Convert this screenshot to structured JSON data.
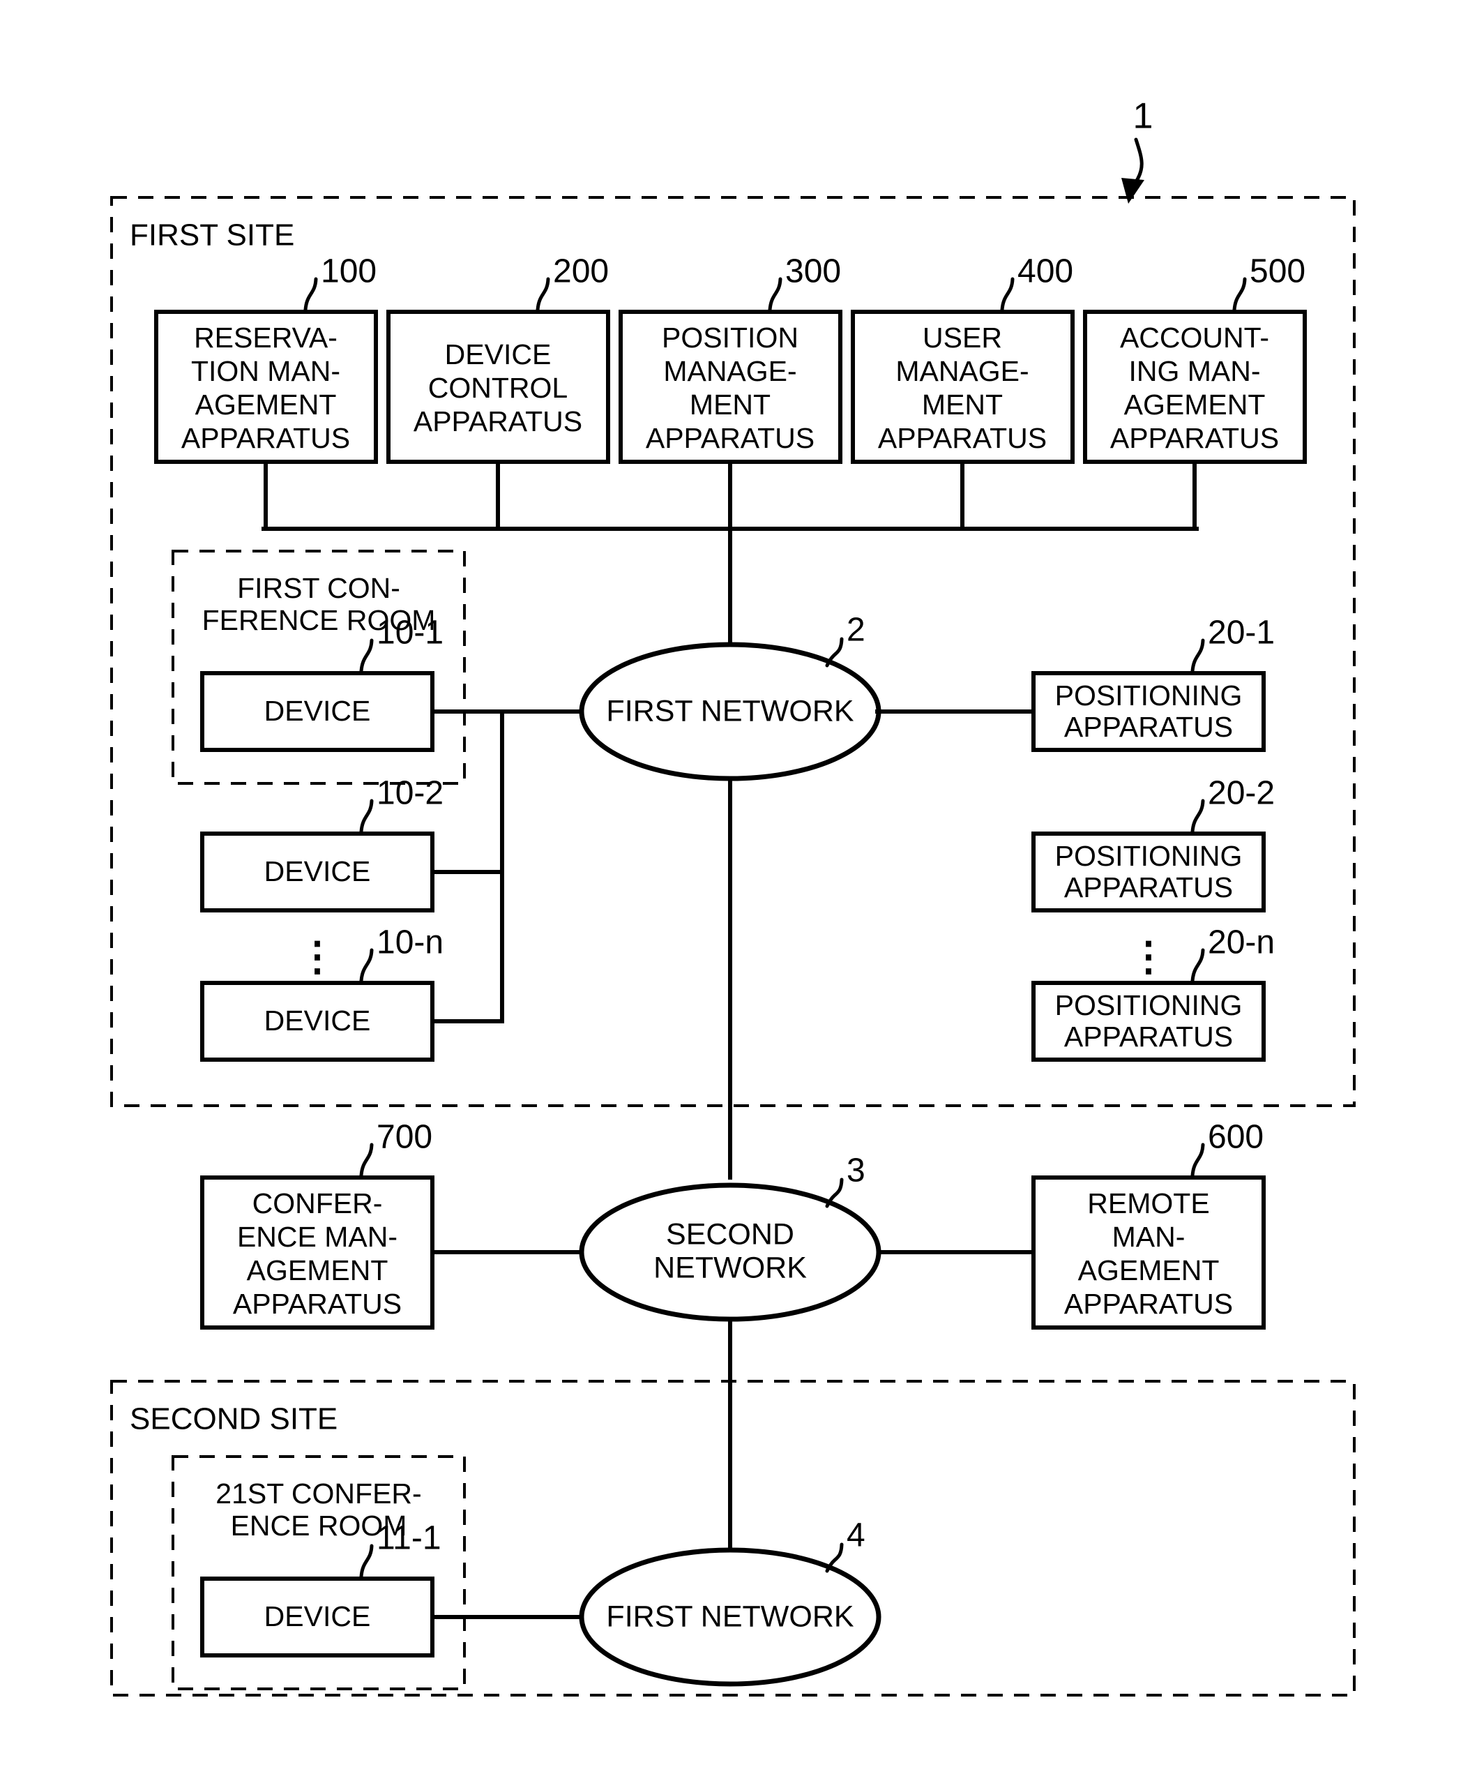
{
  "figure": {
    "reference_label": "1"
  },
  "regions": [
    {
      "id": "first-site",
      "label": "FIRST SITE"
    },
    {
      "id": "second-site",
      "label": "SECOND SITE"
    }
  ],
  "rooms": [
    {
      "id": "first-conference-room",
      "lines": [
        "FIRST CON-",
        "FERENCE ROOM"
      ]
    },
    {
      "id": "twenty-first-conference-room",
      "lines": [
        "21ST CONFER-",
        "ENCE ROOM"
      ]
    }
  ],
  "management_boxes": [
    {
      "ref": "100",
      "lines": [
        "RESERVA-",
        "TION MAN-",
        "AGEMENT",
        "APPARATUS"
      ]
    },
    {
      "ref": "200",
      "lines": [
        "DEVICE",
        "CONTROL",
        "APPARATUS"
      ]
    },
    {
      "ref": "300",
      "lines": [
        "POSITION",
        "MANAGE-",
        "MENT",
        "APPARATUS"
      ]
    },
    {
      "ref": "400",
      "lines": [
        "USER",
        "MANAGE-",
        "MENT",
        "APPARATUS"
      ]
    },
    {
      "ref": "500",
      "lines": [
        "ACCOUNT-",
        "ING MAN-",
        "AGEMENT",
        "APPARATUS"
      ]
    }
  ],
  "devices": [
    {
      "ref": "10-1",
      "label": "DEVICE"
    },
    {
      "ref": "10-2",
      "label": "DEVICE"
    },
    {
      "ref": "10-n",
      "label": "DEVICE"
    },
    {
      "ref": "11-1",
      "label": "DEVICE"
    }
  ],
  "positioning_apparatuses": [
    {
      "ref": "20-1",
      "lines": [
        "POSITIONING",
        "APPARATUS"
      ]
    },
    {
      "ref": "20-2",
      "lines": [
        "POSITIONING",
        "APPARATUS"
      ]
    },
    {
      "ref": "20-n",
      "lines": [
        "POSITIONING",
        "APPARATUS"
      ]
    }
  ],
  "lower_boxes": [
    {
      "ref": "700",
      "lines": [
        "CONFER-",
        "ENCE MAN-",
        "AGEMENT",
        "APPARATUS"
      ]
    },
    {
      "ref": "600",
      "lines": [
        "REMOTE",
        "MAN-",
        "AGEMENT",
        "APPARATUS"
      ]
    }
  ],
  "networks": [
    {
      "ref": "2",
      "lines": [
        "FIRST NETWORK"
      ]
    },
    {
      "ref": "3",
      "lines": [
        "SECOND",
        "NETWORK"
      ]
    },
    {
      "ref": "4",
      "lines": [
        "FIRST NETWORK"
      ]
    }
  ],
  "ellipsis": {
    "devices": "⋮",
    "positioning": "⋮"
  },
  "colors": {
    "stroke": "#000000",
    "fill": "#ffffff"
  }
}
